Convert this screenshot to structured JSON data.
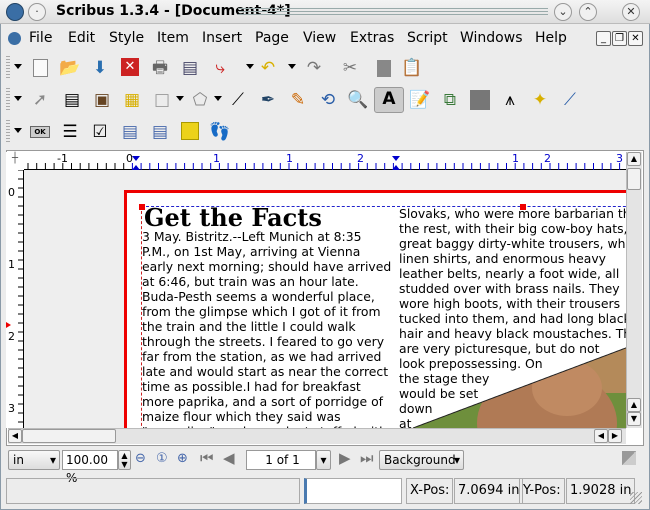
{
  "window": {
    "title": "Scribus 1.3.4 - [Document-4*]"
  },
  "menu": [
    "File",
    "Edit",
    "Style",
    "Item",
    "Insert",
    "Page",
    "View",
    "Extras",
    "Script",
    "Windows",
    "Help"
  ],
  "document": {
    "heading": "Get the Facts",
    "col1": [
      "3 May. Bistritz.--Left Munich at 8:35",
      "P.M., on 1st May, arriving at Vienna",
      "early next morning; should have arrived",
      "at 6:46, but train was an hour late.",
      "Buda-Pesth seems a wonderful place,",
      "from the glimpse which I got of it from",
      "the train and the little I could walk",
      "through the streets. I feared to go very",
      "far from the station, as we had arrived",
      "late and would start as near the correct",
      "time as possible.I had for breakfast",
      "more paprika, and a sort of porridge of",
      "maize flour which they said was",
      "\"mamaliga\", and egg-plant stuffed with"
    ],
    "col2": [
      "Slovaks, who were more barbarian than",
      "the rest, with their big cow-boy hats,",
      "great baggy dirty-white trousers, white",
      "linen shirts, and enormous heavy",
      "leather belts, nearly a foot wide, all",
      "studded over with brass nails. They",
      "wore high boots, with their trousers",
      "tucked into them, and had long black",
      "hair and heavy black moustaches. They",
      "are very picturesque, but do not",
      "look prepossessing. On",
      "the stage they",
      "would be set",
      "down",
      "at"
    ]
  },
  "rulers": {
    "h_labels": [
      "-1",
      "0",
      "1",
      "1",
      "2",
      "1",
      "2",
      "3"
    ],
    "v_labels": [
      "0",
      "1",
      "2",
      "3"
    ]
  },
  "bottombar": {
    "unit": "in",
    "zoom": "100.00 %",
    "page": "1 of 1",
    "layer": "Background"
  },
  "status": {
    "message": "",
    "xpos_label": "X-Pos:",
    "xpos": "7.0694 in",
    "ypos_label": "Y-Pos:",
    "ypos": "1.9028 in"
  }
}
